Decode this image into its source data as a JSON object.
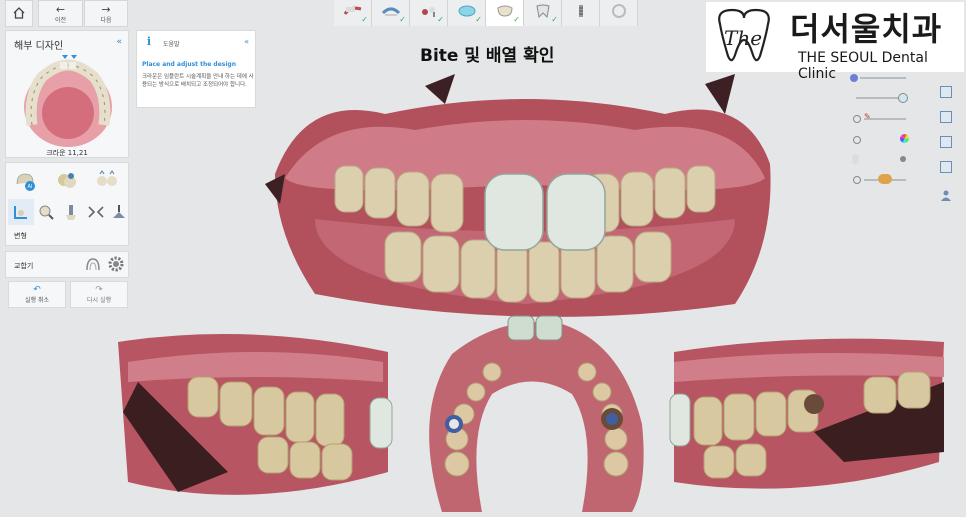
{
  "nav": {
    "home_label": "",
    "prev_label": "이전",
    "next_label": "다음"
  },
  "left_panel": {
    "title": "해부 디자인",
    "crown_caption": "크라운 11,21",
    "deform_label": "변형",
    "occlusion_label": "교합기",
    "undo_label": "실행 취소",
    "redo_label": "다시 실행",
    "collapse_icon": "chevron-left-icon"
  },
  "help": {
    "title": "도움말",
    "heading": "Place and adjust the design",
    "body": "크라운은 임플란트 시술계획을 안내 하는 데에 사용되는 방식으로 배치되고 조정되어야 합니다.",
    "collapse": "«"
  },
  "main": {
    "title": "Bite 및 배열 확인"
  },
  "logo": {
    "korean": "더서울치과",
    "english": "THE SEOUL Dental Clinic",
    "mark": "The"
  },
  "colors": {
    "accent": "#2f8fd8",
    "check": "#3aa655",
    "gum": "#b8505a",
    "tooth": "#dccfae",
    "crown": "#dfe7e0"
  },
  "steps": [
    "scan-icon",
    "model-icon",
    "implant-icon",
    "margin-icon",
    "crown-icon",
    "tooth-icon",
    "screw-icon",
    "finish-icon"
  ]
}
